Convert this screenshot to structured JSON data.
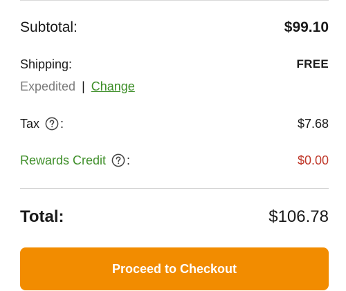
{
  "summary": {
    "subtotal": {
      "label": "Subtotal:",
      "value": "$99.10"
    },
    "shipping": {
      "label": "Shipping:",
      "value": "FREE",
      "method": "Expedited",
      "separator": "|",
      "change_link": "Change"
    },
    "tax": {
      "label": "Tax",
      "suffix": ":",
      "value": "$7.68",
      "help_icon": "question-circle-icon"
    },
    "rewards": {
      "label": "Rewards Credit",
      "suffix": ":",
      "value": "$0.00",
      "help_icon": "question-circle-icon"
    },
    "total": {
      "label": "Total:",
      "value": "$106.78"
    }
  },
  "checkout": {
    "button_label": "Proceed to Checkout"
  },
  "colors": {
    "accent_orange": "#f28c00",
    "link_green": "#3f8f2a",
    "credit_red": "#c0392b",
    "muted_gray": "#7a7a7a"
  }
}
